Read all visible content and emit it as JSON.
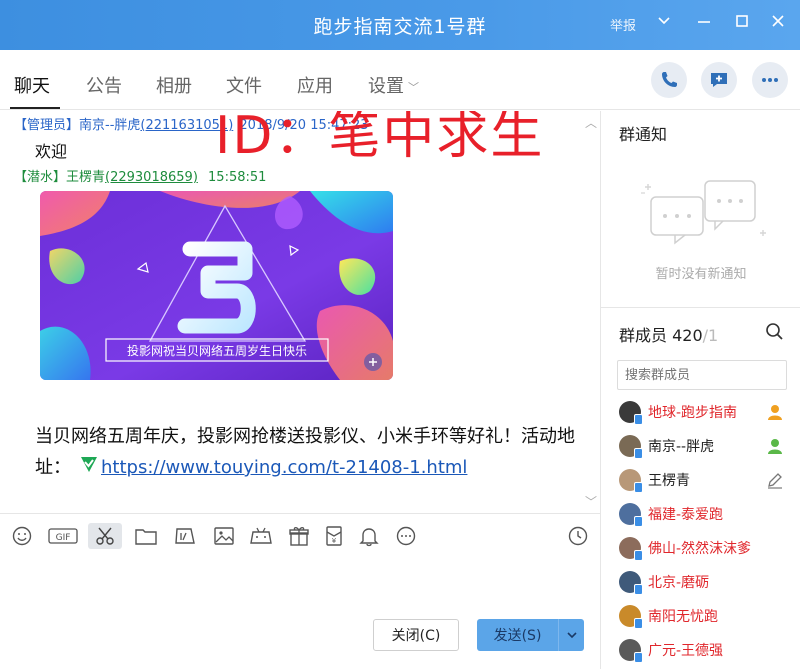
{
  "window": {
    "title": "跑步指南交流1号群",
    "report_label": "举报",
    "minimize": "—",
    "maximize": "☐",
    "close": "✕"
  },
  "tabs": [
    {
      "label": "聊天"
    },
    {
      "label": "公告"
    },
    {
      "label": "相册"
    },
    {
      "label": "文件"
    },
    {
      "label": "应用"
    },
    {
      "label": "设置"
    }
  ],
  "header_actions": [
    "phone-icon",
    "add-chat-icon",
    "more-icon"
  ],
  "chat": {
    "messages": [
      {
        "tag": "【管理员】",
        "name": "南京--胖虎",
        "qq": "(2211631051)",
        "time": "2018/9/20 15:47:23",
        "text": "欢迎"
      },
      {
        "tag": "【潜水】",
        "name": "王楞青",
        "qq": "(2293018659)",
        "time": "15:58:51"
      }
    ],
    "banner": {
      "digit": "5",
      "caption": "投影网祝当贝网络五周岁生日快乐"
    },
    "post_text": "当贝网络五周年庆，投影网抢楼送投影仪、小米手环等好礼！活动地址：",
    "post_link": "https://www.touying.com/t-21408-1.html",
    "watermark": "ID：笔中求生"
  },
  "toolbar_icons": [
    "emoji-icon",
    "gif-icon",
    "scissors-icon",
    "folder-icon",
    "image-edit-icon",
    "image-icon",
    "gamepad-icon",
    "gift-icon",
    "red-packet-icon",
    "bell-icon",
    "more-circle-icon",
    "history-clock-icon"
  ],
  "buttons": {
    "close": "关闭(C)",
    "send": "发送(S)"
  },
  "notice": {
    "title": "群通知",
    "empty": "暂时没有新通知"
  },
  "members": {
    "title": "群成员",
    "count": "420",
    "total": "/1",
    "search_placeholder": "搜索群成员",
    "list": [
      {
        "name": "地球-跑步指南",
        "highlight": true,
        "role": "owner",
        "avatar": "#3a3a3a"
      },
      {
        "name": "南京--胖虎",
        "highlight": false,
        "role": "admin",
        "avatar": "#7a6a55"
      },
      {
        "name": "王楞青",
        "highlight": false,
        "role": "edit",
        "avatar": "#b89878"
      },
      {
        "name": "福建-泰爱跑",
        "highlight": true,
        "role": "",
        "avatar": "#4e6f9e"
      },
      {
        "name": "佛山-然然沫沫爹",
        "highlight": true,
        "role": "",
        "avatar": "#8c6c5c"
      },
      {
        "name": "北京-磨砺",
        "highlight": true,
        "role": "",
        "avatar": "#3f5a7a"
      },
      {
        "name": "南阳无忧跑",
        "highlight": true,
        "role": "",
        "avatar": "#c98a2a"
      },
      {
        "name": "广元-王德强",
        "highlight": true,
        "role": "",
        "avatar": "#5a5a5a"
      }
    ]
  },
  "colors": {
    "titlebar": "#4a9ae8",
    "highlight_name": "#e0272c",
    "admin_tag": "#2a65c8",
    "lurker_tag": "#1e8c3d",
    "link": "#1b58b8",
    "watermark": "#e8202a",
    "send_button": "#5ba5e8"
  }
}
